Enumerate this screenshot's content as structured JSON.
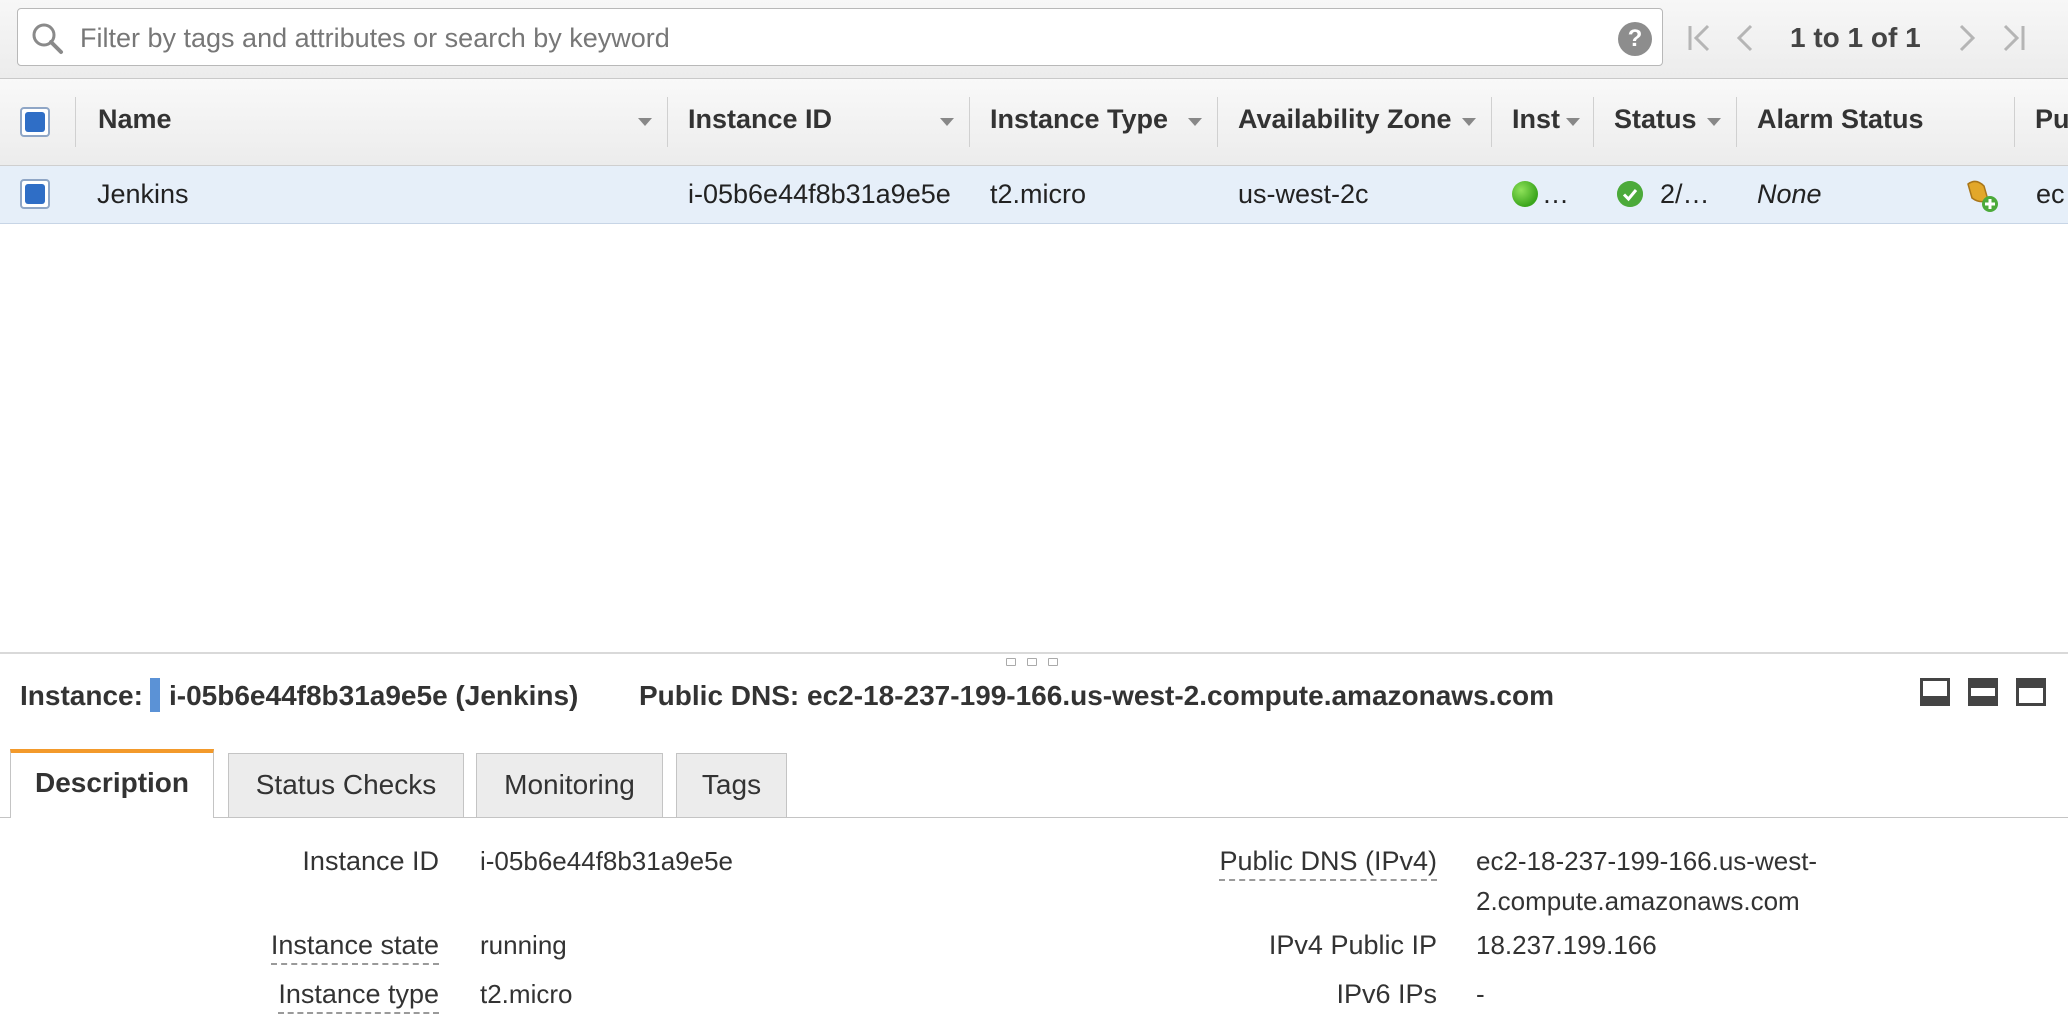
{
  "filter": {
    "placeholder": "Filter by tags and attributes or search by keyword",
    "help_glyph": "?"
  },
  "pager": {
    "text": "1 to 1 of 1"
  },
  "columns": {
    "name": "Name",
    "instance_id": "Instance ID",
    "instance_type": "Instance Type",
    "availability_zone": "Availability Zone",
    "instance_state": "Inst",
    "status": "Status",
    "alarm_status": "Alarm Status",
    "public_dns": "Pu"
  },
  "rows": [
    {
      "name": "Jenkins",
      "instance_id": "i-05b6e44f8b31a9e5e",
      "instance_type": "t2.micro",
      "availability_zone": "us-west-2c",
      "instance_state": "…",
      "status": "2/…",
      "alarm_status": "None",
      "public_dns": "ec"
    }
  ],
  "detail": {
    "instance_label": "Instance:",
    "instance_value": "i-05b6e44f8b31a9e5e (Jenkins)",
    "public_dns_header": "Public DNS: ec2-18-237-199-166.us-west-2.compute.amazonaws.com"
  },
  "tabs": [
    "Description",
    "Status Checks",
    "Monitoring",
    "Tags"
  ],
  "description": {
    "left": [
      {
        "label": "Instance ID",
        "value": "i-05b6e44f8b31a9e5e"
      },
      {
        "label": "Instance state",
        "value": "running"
      },
      {
        "label": "Instance type",
        "value": "t2.micro"
      }
    ],
    "right": [
      {
        "label": "Public DNS (IPv4)",
        "value_line1": "ec2-18-237-199-166.us-west-",
        "value_line2": "2.compute.amazonaws.com"
      },
      {
        "label": "IPv4 Public IP",
        "value": "18.237.199.166"
      },
      {
        "label": "IPv6 IPs",
        "value": "-"
      }
    ]
  },
  "colors": {
    "accent_tab": "#f39a2b",
    "selected_row": "#e6eff9",
    "checkbox_blue": "#2f6ec6",
    "running_green": "#3aa51c"
  }
}
